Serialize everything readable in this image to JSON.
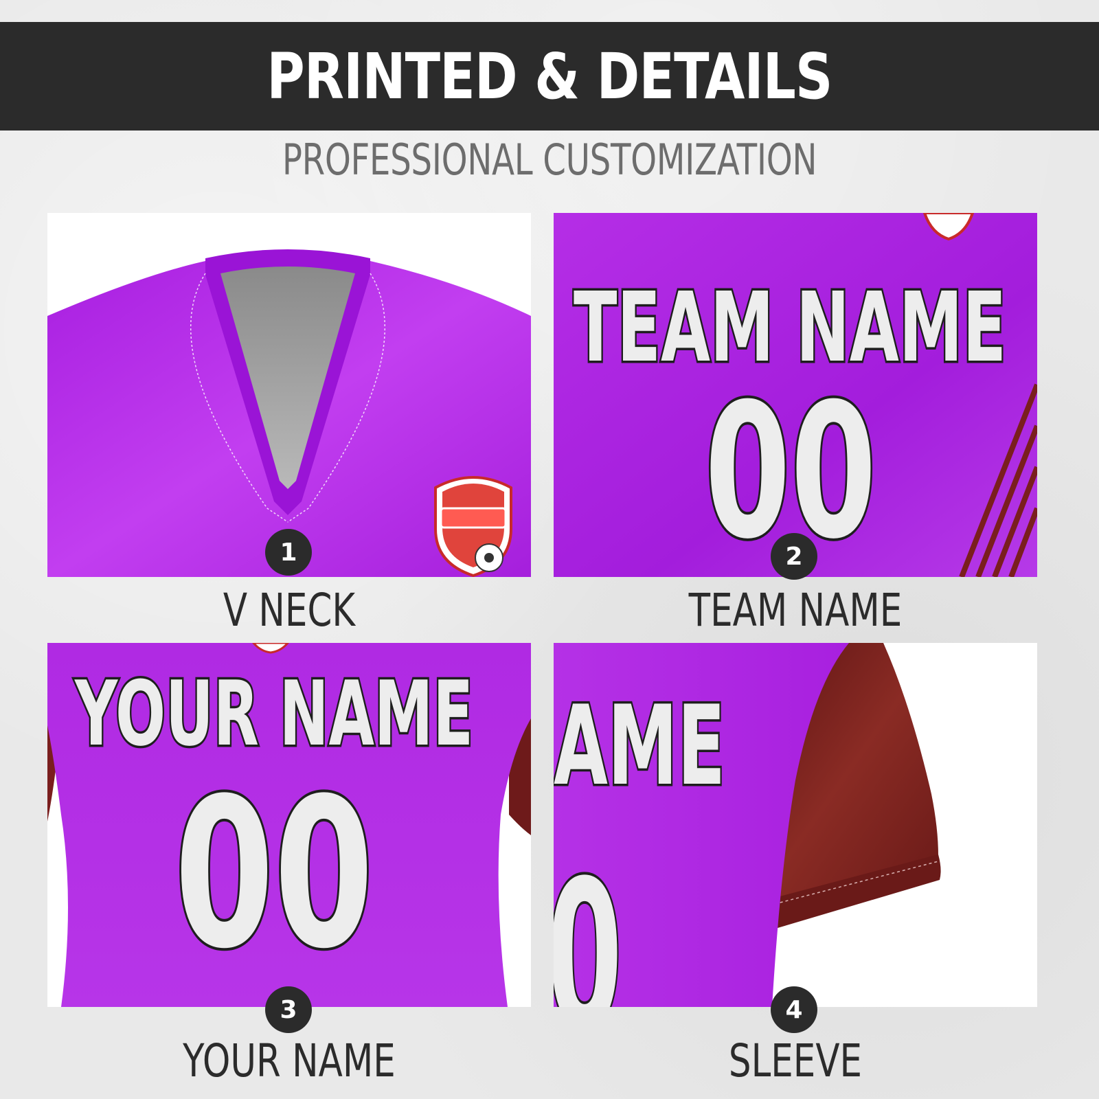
{
  "header": {
    "title": "PRINTED & DETAILS",
    "subtitle": "PROFESSIONAL CUSTOMIZATION"
  },
  "colors": {
    "banner": "#2b2b2b",
    "jersey_purple": "#b02ae0",
    "sleeve_maroon": "#7a1e1e",
    "crest_red": "#e0443c",
    "print_fill": "#ededed",
    "print_outline": "#1e1e1e"
  },
  "panels": [
    {
      "number": "1",
      "label": "V NECK",
      "icon": "v-neck-closeup"
    },
    {
      "number": "2",
      "label": "TEAM NAME",
      "icon": "team-name-print",
      "print_text": "TEAM NAME",
      "print_number": "00"
    },
    {
      "number": "3",
      "label": "YOUR NAME",
      "icon": "player-name-print",
      "print_text": "YOUR NAME",
      "print_number": "00"
    },
    {
      "number": "4",
      "label": "SLEEVE",
      "icon": "sleeve-closeup",
      "print_text": "AME",
      "print_number": "0"
    }
  ]
}
